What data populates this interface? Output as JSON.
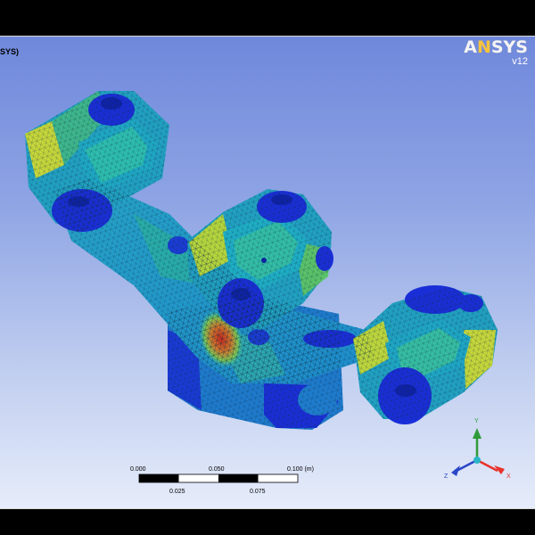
{
  "viewport": {
    "title_fragment": "SYS)",
    "logo": {
      "brand_prefix": "A",
      "brand_accent": "N",
      "brand_suffix": "SYS",
      "version": "v12"
    }
  },
  "scale_bar": {
    "labels_top": [
      "0.000",
      "0.050",
      "0.100 (m)"
    ],
    "labels_bottom": [
      "0.025",
      "0.075"
    ]
  },
  "triad": {
    "y": "Y",
    "z": "Z",
    "x": "X"
  },
  "colors": {
    "contour_blue": "#1a2ed8",
    "contour_cyan": "#1fb1c5",
    "contour_green": "#55c76a",
    "contour_yellow": "#d6dd36",
    "contour_red": "#c8281e",
    "axis_x": "#e8322b",
    "axis_y": "#2e9a39",
    "axis_z": "#2a46c9"
  },
  "model": {
    "name": "meshed-manifold-stress-contour"
  }
}
